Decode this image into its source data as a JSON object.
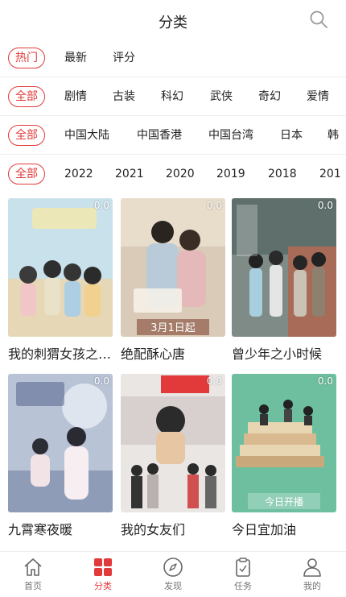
{
  "header": {
    "title": "分类"
  },
  "filters": [
    {
      "options": [
        "热门",
        "最新",
        "评分"
      ],
      "selected": 0
    },
    {
      "options": [
        "全部",
        "剧情",
        "古装",
        "科幻",
        "武侠",
        "奇幻",
        "爱情"
      ],
      "selected": 0
    },
    {
      "options": [
        "全部",
        "中国大陆",
        "中国香港",
        "中国台湾",
        "日本",
        "韩"
      ],
      "selected": 0
    },
    {
      "options": [
        "全部",
        "2022",
        "2021",
        "2020",
        "2019",
        "2018",
        "201"
      ],
      "selected": 0
    }
  ],
  "cards": [
    {
      "title": "我的刺猬女孩之…",
      "score": "0.0",
      "overlay": ""
    },
    {
      "title": "绝配酥心唐",
      "score": "0.0",
      "overlay": "3月1日起"
    },
    {
      "title": "曾少年之小时候",
      "score": "0.0",
      "overlay": ""
    },
    {
      "title": "九霄寒夜暖",
      "score": "0.0",
      "overlay": ""
    },
    {
      "title": "我的女友们",
      "score": "0.0",
      "overlay": ""
    },
    {
      "title": "今日宜加油",
      "score": "0.0",
      "overlay": "今日开播"
    }
  ],
  "tabbar": [
    {
      "label": "首页",
      "icon": "home-icon",
      "active": false
    },
    {
      "label": "分类",
      "icon": "grid-icon",
      "active": true
    },
    {
      "label": "发现",
      "icon": "compass-icon",
      "active": false
    },
    {
      "label": "任务",
      "icon": "clipboard-icon",
      "active": false
    },
    {
      "label": "我的",
      "icon": "person-icon",
      "active": false
    }
  ],
  "colors": {
    "accent": "#e23a3a",
    "text": "#222222",
    "muted": "#777777",
    "divider": "#eeeeee"
  }
}
